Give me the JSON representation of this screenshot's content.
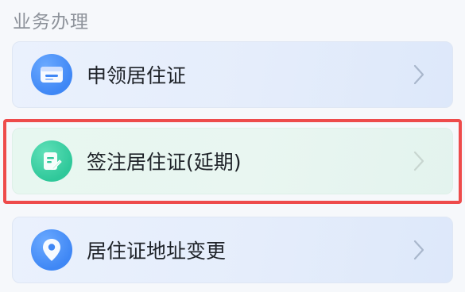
{
  "section": {
    "title": "业务办理"
  },
  "items": [
    {
      "label": "申领居住证",
      "icon": "id-card-icon"
    },
    {
      "label": "签注居住证(延期)",
      "icon": "edit-document-icon"
    },
    {
      "label": "居住证地址变更",
      "icon": "location-pin-icon"
    }
  ],
  "colors": {
    "blue_icon": "#3f87f5",
    "green_icon": "#2fc89a",
    "highlight_border": "#ee4b4b",
    "chevron": "#a9b7cc"
  }
}
